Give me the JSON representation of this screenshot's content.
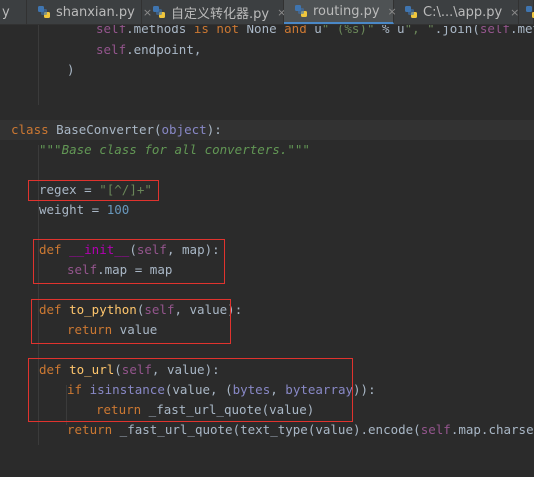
{
  "tabs": [
    {
      "label": "y",
      "active": false,
      "icon": "python-file-icon"
    },
    {
      "label": "shanxian.py",
      "active": false,
      "icon": "python-file-icon"
    },
    {
      "label": "自定义转化器.py",
      "active": false,
      "icon": "python-file-icon"
    },
    {
      "label": "routing.py",
      "active": true,
      "icon": "python-file-icon"
    },
    {
      "label": "C:\\...\\app.py",
      "active": false,
      "icon": "python-file-icon"
    }
  ],
  "tab_close_glyph": "×",
  "code": {
    "l1": {
      "self": "self",
      "t1": ".methods ",
      "kw1": "is not",
      "t2": " None ",
      "kw2": "and",
      "t3": " u",
      "s1": "\" (%s)\"",
      "t4": " % u",
      "s2": "\", \"",
      "t5": ".join(",
      "self2": "self",
      "t6": ".methods"
    },
    "l2": {
      "self": "self",
      "t1": ".endpoint,"
    },
    "l3": {
      "t1": ")"
    },
    "l4": {
      "kw": "class",
      "name": " BaseConverter(",
      "base": "object",
      "end": "):"
    },
    "l5": {
      "doc": "\"\"\"Base class for all converters.\"\"\""
    },
    "l6": {
      "t1": "regex = ",
      "s": "\"[^/]+\""
    },
    "l7": {
      "t1": "weight = ",
      "n": "100"
    },
    "l8": {
      "kw": "def",
      "sp": " ",
      "fn": "__init__",
      "p1": "(",
      "self": "self",
      "p2": ", map):"
    },
    "l9": {
      "self": "self",
      "t1": ".map = map"
    },
    "l10": {
      "kw": "def",
      "fn": " to_python",
      "p1": "(",
      "self": "self",
      "p2": ", value):"
    },
    "l11": {
      "kw": "return",
      "t1": " value"
    },
    "l12": {
      "kw": "def",
      "fn": " to_url",
      "p1": "(",
      "self": "self",
      "p2": ", value):"
    },
    "l13": {
      "kw": "if",
      "b": " isinstance",
      "t1": "(value, (",
      "b2": "bytes",
      "t2": ", ",
      "b3": "bytearray",
      "t3": ")):"
    },
    "l14": {
      "kw": "return",
      "t1": " _fast_url_quote(value)"
    },
    "l15": {
      "kw": "return",
      "t1": " _fast_url_quote(text_type(value).encode(",
      "self": "self",
      "t2": ".map.charset))"
    }
  },
  "colors": {
    "keyword": "#cc7832",
    "string": "#6a8759",
    "self": "#94558d",
    "function": "#ffc66d",
    "annotation_box": "#e0332e",
    "active_tab_underline": "#4a88c7"
  }
}
